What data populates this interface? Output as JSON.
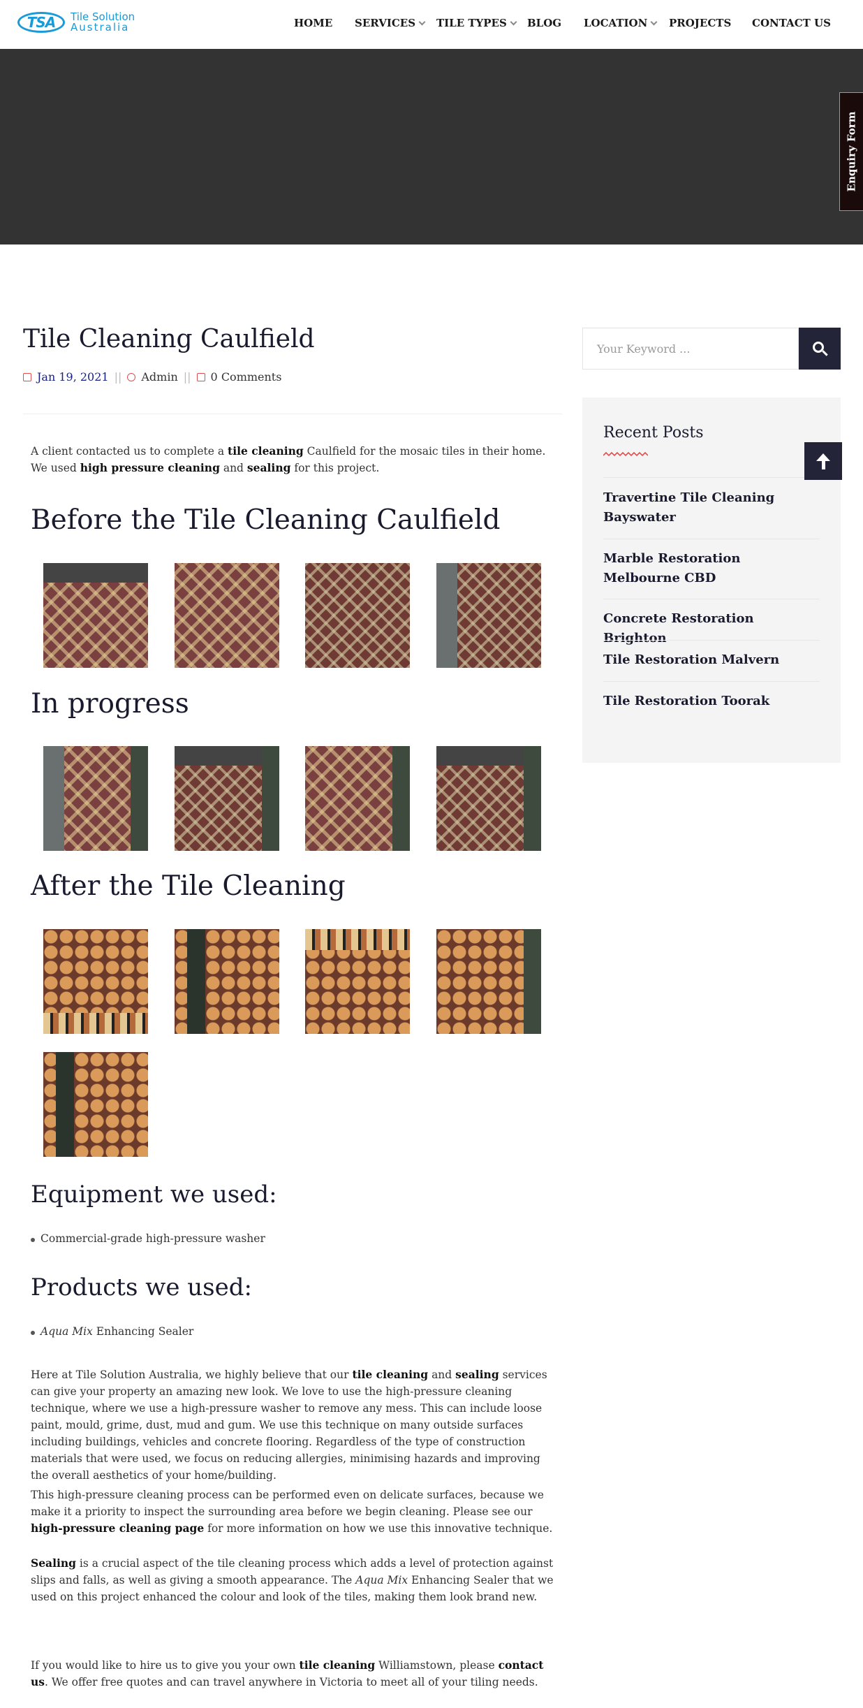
{
  "header": {
    "logo_mark": "TSA",
    "logo_line1": "Tile Solution",
    "logo_line2": "Australia",
    "nav": [
      {
        "label": "HOME",
        "dropdown": false
      },
      {
        "label": "SERVICES",
        "dropdown": true
      },
      {
        "label": "TILE TYPES",
        "dropdown": true
      },
      {
        "label": "BLOG",
        "dropdown": false
      },
      {
        "label": "LOCATION",
        "dropdown": true
      },
      {
        "label": "PROJECTS",
        "dropdown": false
      },
      {
        "label": "CONTACT US",
        "dropdown": false
      }
    ]
  },
  "enquiry_label": "Enquiry Form",
  "post": {
    "title": "Tile Cleaning Caulfield",
    "date": "Jan 19, 2021",
    "author": "Admin",
    "comments": "0 Comments",
    "intro_parts": [
      "A client contacted us to complete a ",
      "tile cleaning",
      " Caulfield for the mosaic tiles in their home. We used ",
      "high pressure cleaning",
      " and ",
      "sealing",
      " for this project."
    ],
    "h_before": "Before the Tile Cleaning Caulfield",
    "h_progress": "In progress",
    "h_after": "After the Tile Cleaning",
    "h_equipment": "Equipment we used:",
    "equipment": [
      "Commercial-grade high-pressure washer"
    ],
    "h_products": "Products we used:",
    "product_italic": "Aqua Mix",
    "product_rest": " Enhancing Sealer",
    "p1_parts": [
      "Here at Tile Solution Australia, we highly believe that our ",
      "tile cleaning",
      " and ",
      "sealing",
      " services can give your property an amazing new look. We love to use the high-pressure cleaning technique, where we use a high-pressure washer to remove any mess. This can include loose paint, mould, grime, dust, mud and gum. We use this technique on many outside surfaces including buildings, vehicles and concrete flooring. Regardless of the type of construction materials that were used, we focus on reducing allergies, minimising hazards and improving the overall aesthetics of your home/building."
    ],
    "p2_parts": [
      "This high-pressure cleaning process can be performed even on delicate surfaces, because we make it a priority to inspect the surrounding area before we begin cleaning. Please see our ",
      "high-pressure cleaning page",
      " for more information on how we use this innovative technique."
    ],
    "p3_parts": [
      "Sealing",
      " is a crucial aspect of the tile cleaning process which adds a level of protection against slips and falls, as well as giving a smooth appearance. The ",
      "Aqua Mix",
      " Enhancing Sealer that we used on this project enhanced the colour and look of the tiles, making them look brand new."
    ],
    "p4_parts": [
      "If you would like to hire us to give you your own ",
      "tile cleaning",
      " Williamstown, please ",
      "contact us",
      ". We offer free quotes and can travel anywhere in Victoria to meet all of your tiling needs."
    ]
  },
  "sidebar": {
    "search_placeholder": "Your Keyword ...",
    "recent_title": "Recent Posts",
    "recent_posts": [
      "Travertine Tile Cleaning Bayswater",
      "Marble Restoration Melbourne CBD",
      "Concrete Restoration Brighton",
      "Tile Restoration Malvern",
      "Tile Restoration Toorak"
    ]
  },
  "colors": {
    "brand_blue": "#1a9ad6",
    "hero_bg": "#333333",
    "accent_red": "#e05050",
    "dark_button": "#242438"
  }
}
